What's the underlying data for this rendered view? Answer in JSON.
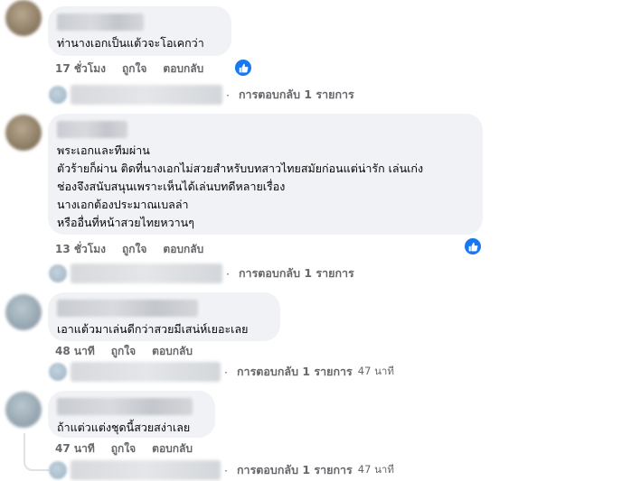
{
  "actions": {
    "like": "ถูกใจ",
    "reply": "ตอบกลับ"
  },
  "comments": [
    {
      "text": "ท่านางเอกเป็นแต้วจะโอเคกว่า",
      "time": "17 ชั่วโมง",
      "reply_summary": "การตอบกลับ 1 รายการ",
      "reply_time": ""
    },
    {
      "text": "พระเอกและทีมผ่าน\nตัวร้ายก็ผ่าน ติดที่นางเอกไม่สวยสำหรับบทสาวไทยสมัยก่อนแต่น่ารัก เล่นเก่ง\nช่องจึงสนับสนุนเพราะเห็นได้เล่นบทดีหลายเรื่อง\nนางเอกต้องประมาณเบลล่า\nหรืออื่นที่หน้าสวยไทยหวานๆ",
      "time": "13 ชั่วโมง",
      "reply_summary": "การตอบกลับ 1 รายการ",
      "reply_time": ""
    },
    {
      "text": "เอาแต้วมาเล่นดีกว่าสวยมีเสน่ห์เยอะเลย",
      "time": "48 นาที",
      "reply_summary": "การตอบกลับ 1 รายการ",
      "reply_time": "47 นาที"
    },
    {
      "text": "ถ้าแต่วแต่งชุดนี้สวยสง่าเลย",
      "time": "47 นาที",
      "reply_summary": "การตอบกลับ 1 รายการ",
      "reply_time": "47 นาที"
    }
  ],
  "icons": {
    "like_badge": "thumbs-up-icon",
    "reaction_color": "#1877f2"
  }
}
